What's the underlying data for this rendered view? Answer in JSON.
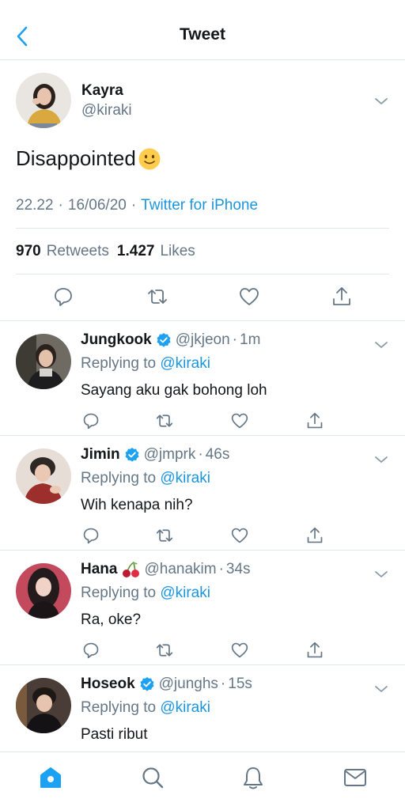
{
  "header": {
    "title": "Tweet",
    "back_icon": "chevron-left-icon"
  },
  "colors": {
    "accent": "#1da1f2",
    "link": "#1b95e0",
    "muted": "#657786",
    "border": "#e1e8ed"
  },
  "main_tweet": {
    "name": "Kayra",
    "handle": "@kiraki",
    "text": "Disappointed",
    "emoji": "slightly-smiling-face",
    "time": "22.22",
    "date": "16/06/20",
    "client": "Twitter for iPhone",
    "retweets_count": "970",
    "retweets_label": "Retweets",
    "likes_count": "1.427",
    "likes_label": "Likes"
  },
  "replies": [
    {
      "name": "Jungkook",
      "verified": true,
      "handle": "@jkjeon",
      "time": "1m",
      "replying_prefix": "Replying to",
      "replying_to": "@kiraki",
      "text": "Sayang aku gak bohong loh"
    },
    {
      "name": "Jimin",
      "verified": true,
      "handle": "@jmprk",
      "time": "46s",
      "replying_prefix": "Replying to",
      "replying_to": "@kiraki",
      "text": "Wih kenapa nih?"
    },
    {
      "name": "Hana",
      "verified": false,
      "name_emoji": "cherries",
      "handle": "@hanakim",
      "time": "34s",
      "replying_prefix": "Replying to",
      "replying_to": "@kiraki",
      "text": "Ra, oke?"
    },
    {
      "name": "Hoseok",
      "verified": true,
      "handle": "@junghs",
      "time": "15s",
      "replying_prefix": "Replying to",
      "replying_to": "@kiraki",
      "text": "Pasti ribut"
    }
  ],
  "tabbar": {
    "items": [
      "home-icon",
      "search-icon",
      "bell-icon",
      "mail-icon"
    ],
    "active": "home-icon"
  },
  "separator": "·"
}
